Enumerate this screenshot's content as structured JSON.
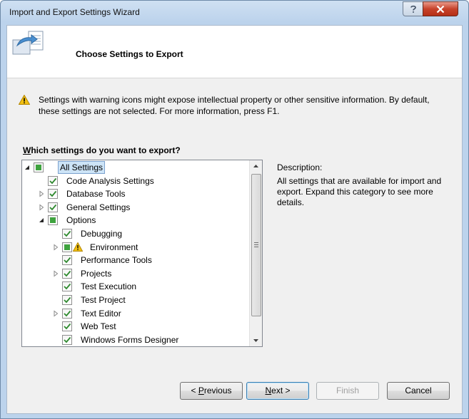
{
  "window": {
    "title": "Import and Export Settings Wizard"
  },
  "header": {
    "title": "Choose Settings to Export"
  },
  "warning": {
    "text": "Settings with warning icons might expose intellectual property or other sensitive information. By default, these settings are not selected. For more information, press F1."
  },
  "question": {
    "prefix": "W",
    "rest": "hich settings do you want to export?"
  },
  "tree": {
    "items": [
      {
        "label": "All Settings",
        "level": 0,
        "expander": "expanded",
        "check": "partial",
        "selected": true
      },
      {
        "label": "Code Analysis Settings",
        "level": 1,
        "expander": "none",
        "check": "checked"
      },
      {
        "label": "Database Tools",
        "level": 1,
        "expander": "collapsed",
        "check": "checked"
      },
      {
        "label": "General Settings",
        "level": 1,
        "expander": "collapsed",
        "check": "checked"
      },
      {
        "label": "Options",
        "level": 1,
        "expander": "expanded",
        "check": "partial"
      },
      {
        "label": "Debugging",
        "level": 2,
        "expander": "none",
        "check": "checked"
      },
      {
        "label": "Environment",
        "level": 2,
        "expander": "collapsed",
        "check": "partial",
        "warning": true
      },
      {
        "label": "Performance Tools",
        "level": 2,
        "expander": "none",
        "check": "checked"
      },
      {
        "label": "Projects",
        "level": 2,
        "expander": "collapsed",
        "check": "checked"
      },
      {
        "label": "Test Execution",
        "level": 2,
        "expander": "none",
        "check": "checked"
      },
      {
        "label": "Test Project",
        "level": 2,
        "expander": "none",
        "check": "checked"
      },
      {
        "label": "Text Editor",
        "level": 2,
        "expander": "collapsed",
        "check": "checked"
      },
      {
        "label": "Web Test",
        "level": 2,
        "expander": "none",
        "check": "checked"
      },
      {
        "label": "Windows Forms Designer",
        "level": 2,
        "expander": "none",
        "check": "checked"
      }
    ]
  },
  "description": {
    "label": "Description:",
    "text": "All settings that are available for import and export. Expand this category to see more details."
  },
  "buttons": {
    "previous": {
      "prefix": "< ",
      "accel": "P",
      "rest": "revious"
    },
    "next": {
      "accel": "N",
      "rest": "ext >"
    },
    "finish": {
      "label": "Finish"
    },
    "cancel": {
      "label": "Cancel"
    }
  },
  "colors": {
    "check": "#2f8a2f",
    "partial": "#3fa33f",
    "warning": "#f2c012",
    "selection": "#cde4f7"
  }
}
